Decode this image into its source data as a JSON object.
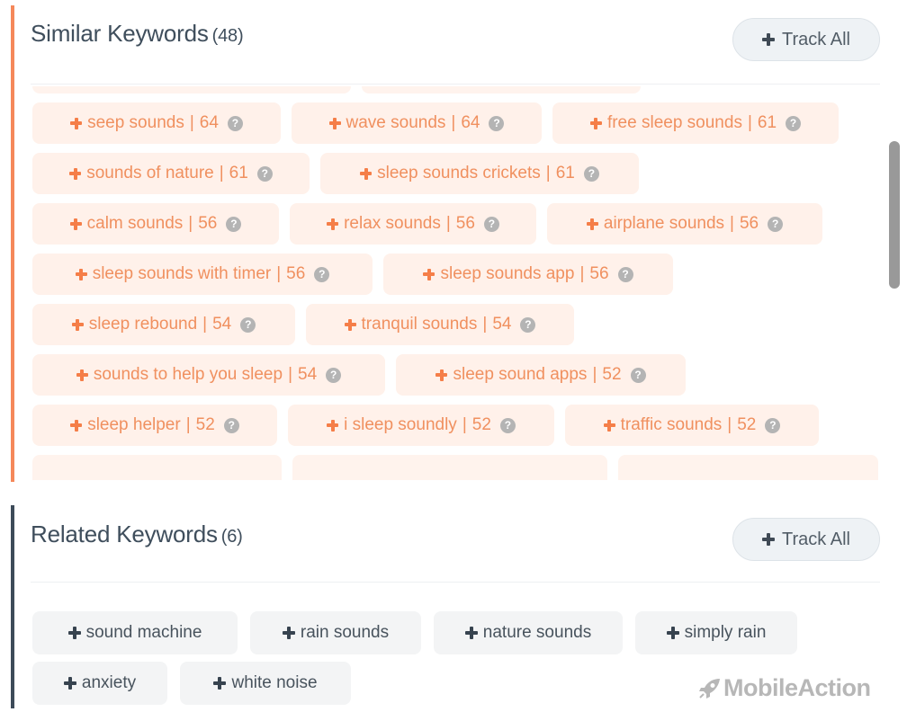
{
  "similar": {
    "title": "Similar Keywords",
    "count": "(48)",
    "track_all_label": "Track All",
    "accent_color": "#f5885a",
    "keywords": [
      {
        "term": "seep sounds",
        "score": "64"
      },
      {
        "term": "wave sounds",
        "score": "64"
      },
      {
        "term": "free sleep sounds",
        "score": "61"
      },
      {
        "term": "sounds of nature",
        "score": "61"
      },
      {
        "term": "sleep sounds crickets",
        "score": "61"
      },
      {
        "term": "calm sounds",
        "score": "56"
      },
      {
        "term": "relax sounds",
        "score": "56"
      },
      {
        "term": "airplane sounds",
        "score": "56"
      },
      {
        "term": "sleep sounds with timer",
        "score": "56"
      },
      {
        "term": "sleep sounds app",
        "score": "56"
      },
      {
        "term": "sleep rebound",
        "score": "54"
      },
      {
        "term": "tranquil sounds",
        "score": "54"
      },
      {
        "term": "sounds to help you sleep",
        "score": "54"
      },
      {
        "term": "sleep sound apps",
        "score": "52"
      },
      {
        "term": "sleep helper",
        "score": "52"
      },
      {
        "term": "i sleep soundly",
        "score": "52"
      },
      {
        "term": "traffic sounds",
        "score": "52"
      }
    ],
    "separator": "|",
    "help_glyph": "?"
  },
  "related": {
    "title": "Related Keywords",
    "count": "(6)",
    "track_all_label": "Track All",
    "accent_color": "#3d4b59",
    "keywords": [
      "sound machine",
      "rain sounds",
      "nature sounds",
      "simply rain",
      "anxiety",
      "white noise"
    ]
  },
  "brand": {
    "name": "MobileAction",
    "icon": "rocket-icon"
  }
}
